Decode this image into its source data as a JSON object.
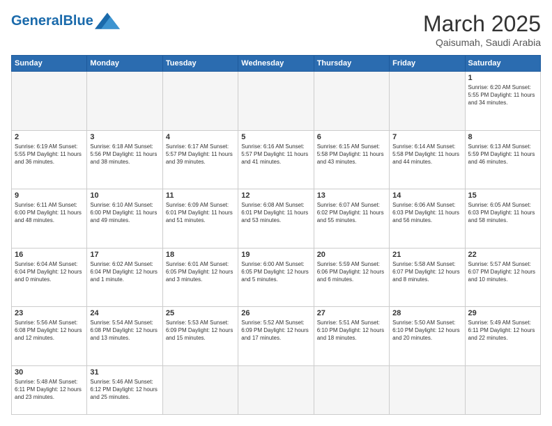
{
  "header": {
    "logo_general": "General",
    "logo_blue": "Blue",
    "month_title": "March 2025",
    "location": "Qaisumah, Saudi Arabia"
  },
  "days_of_week": [
    "Sunday",
    "Monday",
    "Tuesday",
    "Wednesday",
    "Thursday",
    "Friday",
    "Saturday"
  ],
  "weeks": [
    [
      {
        "day": "",
        "info": ""
      },
      {
        "day": "",
        "info": ""
      },
      {
        "day": "",
        "info": ""
      },
      {
        "day": "",
        "info": ""
      },
      {
        "day": "",
        "info": ""
      },
      {
        "day": "",
        "info": ""
      },
      {
        "day": "1",
        "info": "Sunrise: 6:20 AM\nSunset: 5:55 PM\nDaylight: 11 hours and 34 minutes."
      }
    ],
    [
      {
        "day": "2",
        "info": "Sunrise: 6:19 AM\nSunset: 5:55 PM\nDaylight: 11 hours and 36 minutes."
      },
      {
        "day": "3",
        "info": "Sunrise: 6:18 AM\nSunset: 5:56 PM\nDaylight: 11 hours and 38 minutes."
      },
      {
        "day": "4",
        "info": "Sunrise: 6:17 AM\nSunset: 5:57 PM\nDaylight: 11 hours and 39 minutes."
      },
      {
        "day": "5",
        "info": "Sunrise: 6:16 AM\nSunset: 5:57 PM\nDaylight: 11 hours and 41 minutes."
      },
      {
        "day": "6",
        "info": "Sunrise: 6:15 AM\nSunset: 5:58 PM\nDaylight: 11 hours and 43 minutes."
      },
      {
        "day": "7",
        "info": "Sunrise: 6:14 AM\nSunset: 5:58 PM\nDaylight: 11 hours and 44 minutes."
      },
      {
        "day": "8",
        "info": "Sunrise: 6:13 AM\nSunset: 5:59 PM\nDaylight: 11 hours and 46 minutes."
      }
    ],
    [
      {
        "day": "9",
        "info": "Sunrise: 6:11 AM\nSunset: 6:00 PM\nDaylight: 11 hours and 48 minutes."
      },
      {
        "day": "10",
        "info": "Sunrise: 6:10 AM\nSunset: 6:00 PM\nDaylight: 11 hours and 49 minutes."
      },
      {
        "day": "11",
        "info": "Sunrise: 6:09 AM\nSunset: 6:01 PM\nDaylight: 11 hours and 51 minutes."
      },
      {
        "day": "12",
        "info": "Sunrise: 6:08 AM\nSunset: 6:01 PM\nDaylight: 11 hours and 53 minutes."
      },
      {
        "day": "13",
        "info": "Sunrise: 6:07 AM\nSunset: 6:02 PM\nDaylight: 11 hours and 55 minutes."
      },
      {
        "day": "14",
        "info": "Sunrise: 6:06 AM\nSunset: 6:03 PM\nDaylight: 11 hours and 56 minutes."
      },
      {
        "day": "15",
        "info": "Sunrise: 6:05 AM\nSunset: 6:03 PM\nDaylight: 11 hours and 58 minutes."
      }
    ],
    [
      {
        "day": "16",
        "info": "Sunrise: 6:04 AM\nSunset: 6:04 PM\nDaylight: 12 hours and 0 minutes."
      },
      {
        "day": "17",
        "info": "Sunrise: 6:02 AM\nSunset: 6:04 PM\nDaylight: 12 hours and 1 minute."
      },
      {
        "day": "18",
        "info": "Sunrise: 6:01 AM\nSunset: 6:05 PM\nDaylight: 12 hours and 3 minutes."
      },
      {
        "day": "19",
        "info": "Sunrise: 6:00 AM\nSunset: 6:05 PM\nDaylight: 12 hours and 5 minutes."
      },
      {
        "day": "20",
        "info": "Sunrise: 5:59 AM\nSunset: 6:06 PM\nDaylight: 12 hours and 6 minutes."
      },
      {
        "day": "21",
        "info": "Sunrise: 5:58 AM\nSunset: 6:07 PM\nDaylight: 12 hours and 8 minutes."
      },
      {
        "day": "22",
        "info": "Sunrise: 5:57 AM\nSunset: 6:07 PM\nDaylight: 12 hours and 10 minutes."
      }
    ],
    [
      {
        "day": "23",
        "info": "Sunrise: 5:56 AM\nSunset: 6:08 PM\nDaylight: 12 hours and 12 minutes."
      },
      {
        "day": "24",
        "info": "Sunrise: 5:54 AM\nSunset: 6:08 PM\nDaylight: 12 hours and 13 minutes."
      },
      {
        "day": "25",
        "info": "Sunrise: 5:53 AM\nSunset: 6:09 PM\nDaylight: 12 hours and 15 minutes."
      },
      {
        "day": "26",
        "info": "Sunrise: 5:52 AM\nSunset: 6:09 PM\nDaylight: 12 hours and 17 minutes."
      },
      {
        "day": "27",
        "info": "Sunrise: 5:51 AM\nSunset: 6:10 PM\nDaylight: 12 hours and 18 minutes."
      },
      {
        "day": "28",
        "info": "Sunrise: 5:50 AM\nSunset: 6:10 PM\nDaylight: 12 hours and 20 minutes."
      },
      {
        "day": "29",
        "info": "Sunrise: 5:49 AM\nSunset: 6:11 PM\nDaylight: 12 hours and 22 minutes."
      }
    ],
    [
      {
        "day": "30",
        "info": "Sunrise: 5:48 AM\nSunset: 6:11 PM\nDaylight: 12 hours and 23 minutes."
      },
      {
        "day": "31",
        "info": "Sunrise: 5:46 AM\nSunset: 6:12 PM\nDaylight: 12 hours and 25 minutes."
      },
      {
        "day": "",
        "info": ""
      },
      {
        "day": "",
        "info": ""
      },
      {
        "day": "",
        "info": ""
      },
      {
        "day": "",
        "info": ""
      },
      {
        "day": "",
        "info": ""
      }
    ]
  ]
}
